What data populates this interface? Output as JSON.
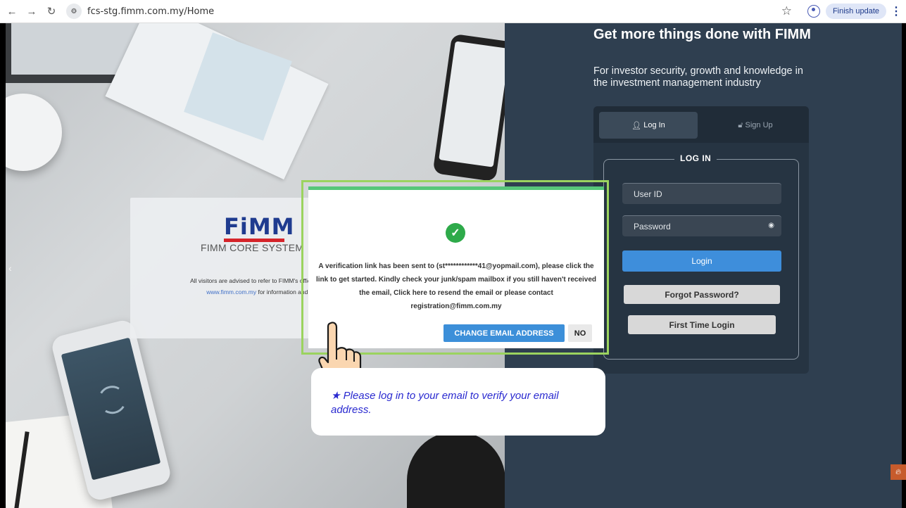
{
  "browser": {
    "url": "fcs-stg.fimm.com.my/Home",
    "finish_update": "Finish update"
  },
  "left_panel": {
    "logo_text": "FiMM",
    "system_name": "FIMM CORE SYSTEM",
    "notice_line1": "All visitors are advised to refer to FIMM's official ve",
    "notice_link": "www.fimm.com.my",
    "notice_line2_rest": " for information and updat"
  },
  "right_panel": {
    "title": "Get more things done with FIMM",
    "subtitle": "For investor security, growth and knowledge in the investment management industry",
    "tab_login": "Log In",
    "tab_signup": "Sign Up",
    "legend": "LOG IN",
    "userid_placeholder": "User ID",
    "password_placeholder": "Password",
    "login_button": "Login",
    "forgot_button": "Forgot Password?",
    "first_time_button": "First Time Login"
  },
  "modal": {
    "message": "A verification link has been sent to (st************41@yopmail.com), please click the link to get started. Kindly check your junk/spam mailbox if you still haven't received the email, Click here to resend the email or please contact registration@fimm.com.my",
    "change_email_button": "CHANGE EMAIL ADDRESS",
    "no_button": "NO"
  },
  "callout": {
    "text": "★ Please log in to your email to verify your email address."
  },
  "colors": {
    "accent_blue": "#3c8fd9",
    "success_green": "#2eaa4a",
    "highlight_outline": "#9bd35f",
    "panel_dark": "#2f3f50",
    "callout_text": "#2a2ad0"
  }
}
